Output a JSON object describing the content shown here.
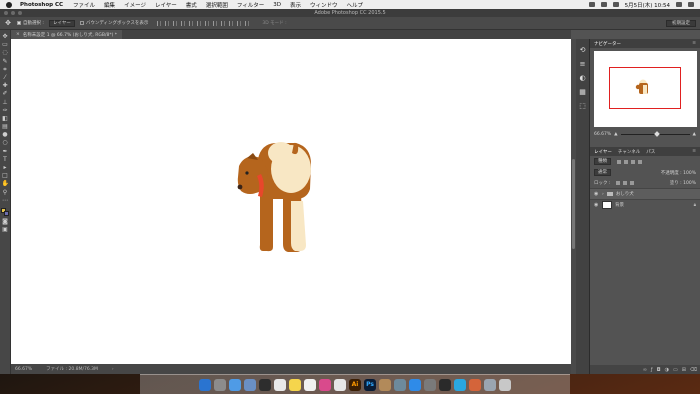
{
  "menubar": {
    "app_name": "Photoshop CC",
    "menus": [
      "ファイル",
      "編集",
      "イメージ",
      "レイヤー",
      "書式",
      "選択範囲",
      "フィルター",
      "3D",
      "表示",
      "ウィンドウ",
      "ヘルプ"
    ],
    "clock": "5月5日(木) 10:54"
  },
  "window": {
    "title": "Adobe Photoshop CC 2015.5"
  },
  "options": {
    "auto_select_label": "自動選択 :",
    "auto_select_target": "レイヤー",
    "bounding_box_label": "バウンディングボックスを表示",
    "mode_3d_label": "3D モード :",
    "workspace": "初期設定"
  },
  "document": {
    "tab_label": "名称未設定 1 @ 66.7% (おしり犬, RGB/8*) *"
  },
  "status": {
    "zoom": "66.67%",
    "file_info": "ファイル : 20.8M/76.3M"
  },
  "navigator": {
    "tab": "ナビゲーター",
    "zoom": "66.67%",
    "zoom_fraction": 0.5
  },
  "layers": {
    "tabs": [
      "レイヤー",
      "チャンネル",
      "パス"
    ],
    "filter_kind": "種類",
    "blend_mode": "通常",
    "opacity_label": "不透明度 : 100%",
    "lock_label": "ロック :",
    "fill_label": "塗り : 100%",
    "rows": [
      {
        "name": "おしり犬",
        "type": "group",
        "selected": true
      },
      {
        "name": "背景",
        "type": "background",
        "selected": false
      }
    ]
  },
  "colors": {
    "dog_body": "#b5651d",
    "dog_cream": "#f8e7c4",
    "collar": "#e8472b",
    "foreground_swatch": "#e6c44a",
    "background_swatch": "#6d6fb0"
  },
  "dock": {
    "ai_label": "Ai",
    "ps_label": "Ps"
  }
}
